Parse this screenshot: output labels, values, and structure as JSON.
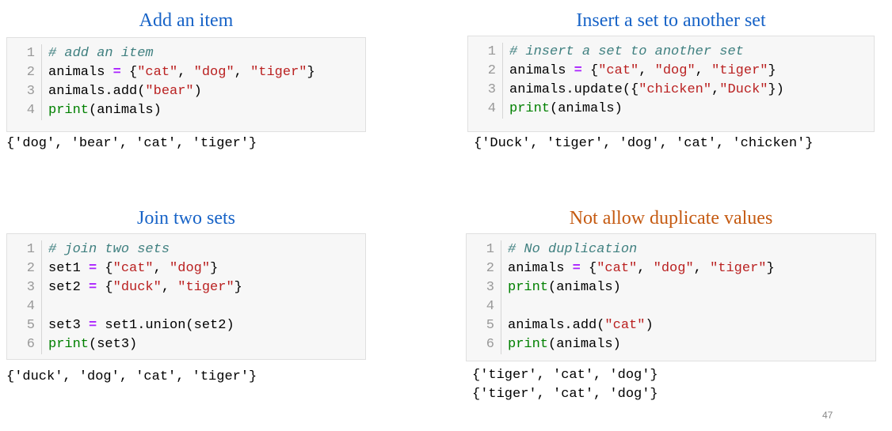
{
  "panels": {
    "add_item": {
      "title": "Add an item",
      "lines": [
        {
          "num": "1",
          "tokens": [
            {
              "t": "# add an item",
              "k": "comment"
            }
          ]
        },
        {
          "num": "2",
          "tokens": [
            {
              "t": "animals ",
              "k": "punct"
            },
            {
              "t": "=",
              "k": "op"
            },
            {
              "t": " {",
              "k": "punct"
            },
            {
              "t": "\"cat\"",
              "k": "str"
            },
            {
              "t": ", ",
              "k": "punct"
            },
            {
              "t": "\"dog\"",
              "k": "str"
            },
            {
              "t": ", ",
              "k": "punct"
            },
            {
              "t": "\"tiger\"",
              "k": "str"
            },
            {
              "t": "}",
              "k": "punct"
            }
          ]
        },
        {
          "num": "3",
          "tokens": [
            {
              "t": "animals.add(",
              "k": "punct"
            },
            {
              "t": "\"bear\"",
              "k": "str"
            },
            {
              "t": ")",
              "k": "punct"
            }
          ]
        },
        {
          "num": "4",
          "tokens": [
            {
              "t": "print",
              "k": "fn"
            },
            {
              "t": "(animals)",
              "k": "punct"
            }
          ]
        }
      ],
      "output": [
        "{'dog', 'bear', 'cat', 'tiger'}"
      ]
    },
    "insert_set": {
      "title": "Insert a set to another set",
      "lines": [
        {
          "num": "1",
          "tokens": [
            {
              "t": "# insert a set to another set",
              "k": "comment"
            }
          ]
        },
        {
          "num": "2",
          "tokens": [
            {
              "t": "animals ",
              "k": "punct"
            },
            {
              "t": "=",
              "k": "op"
            },
            {
              "t": " {",
              "k": "punct"
            },
            {
              "t": "\"cat\"",
              "k": "str"
            },
            {
              "t": ", ",
              "k": "punct"
            },
            {
              "t": "\"dog\"",
              "k": "str"
            },
            {
              "t": ", ",
              "k": "punct"
            },
            {
              "t": "\"tiger\"",
              "k": "str"
            },
            {
              "t": "}",
              "k": "punct"
            }
          ]
        },
        {
          "num": "3",
          "tokens": [
            {
              "t": "animals.update({",
              "k": "punct"
            },
            {
              "t": "\"chicken\"",
              "k": "str"
            },
            {
              "t": ",",
              "k": "punct"
            },
            {
              "t": "\"Duck\"",
              "k": "str"
            },
            {
              "t": "})",
              "k": "punct"
            }
          ]
        },
        {
          "num": "4",
          "tokens": [
            {
              "t": "print",
              "k": "fn"
            },
            {
              "t": "(animals)",
              "k": "punct"
            }
          ]
        }
      ],
      "output": [
        "{'Duck', 'tiger', 'dog', 'cat', 'chicken'}"
      ]
    },
    "join_sets": {
      "title": "Join two sets",
      "lines": [
        {
          "num": "1",
          "tokens": [
            {
              "t": "# join two sets",
              "k": "comment"
            }
          ]
        },
        {
          "num": "2",
          "tokens": [
            {
              "t": "set1 ",
              "k": "punct"
            },
            {
              "t": "=",
              "k": "op"
            },
            {
              "t": " {",
              "k": "punct"
            },
            {
              "t": "\"cat\"",
              "k": "str"
            },
            {
              "t": ", ",
              "k": "punct"
            },
            {
              "t": "\"dog\"",
              "k": "str"
            },
            {
              "t": "}",
              "k": "punct"
            }
          ]
        },
        {
          "num": "3",
          "tokens": [
            {
              "t": "set2 ",
              "k": "punct"
            },
            {
              "t": "=",
              "k": "op"
            },
            {
              "t": " {",
              "k": "punct"
            },
            {
              "t": "\"duck\"",
              "k": "str"
            },
            {
              "t": ", ",
              "k": "punct"
            },
            {
              "t": "\"tiger\"",
              "k": "str"
            },
            {
              "t": "}",
              "k": "punct"
            }
          ]
        },
        {
          "num": "4",
          "tokens": []
        },
        {
          "num": "5",
          "tokens": [
            {
              "t": "set3 ",
              "k": "punct"
            },
            {
              "t": "=",
              "k": "op"
            },
            {
              "t": " set1.union(set2)",
              "k": "punct"
            }
          ]
        },
        {
          "num": "6",
          "tokens": [
            {
              "t": "print",
              "k": "fn"
            },
            {
              "t": "(set3)",
              "k": "punct"
            }
          ]
        }
      ],
      "output": [
        "{'duck', 'dog', 'cat', 'tiger'}"
      ]
    },
    "no_duplicates": {
      "title": "Not allow duplicate values",
      "lines": [
        {
          "num": "1",
          "tokens": [
            {
              "t": "# No duplication",
              "k": "comment"
            }
          ]
        },
        {
          "num": "2",
          "tokens": [
            {
              "t": "animals ",
              "k": "punct"
            },
            {
              "t": "=",
              "k": "op"
            },
            {
              "t": " {",
              "k": "punct"
            },
            {
              "t": "\"cat\"",
              "k": "str"
            },
            {
              "t": ", ",
              "k": "punct"
            },
            {
              "t": "\"dog\"",
              "k": "str"
            },
            {
              "t": ", ",
              "k": "punct"
            },
            {
              "t": "\"tiger\"",
              "k": "str"
            },
            {
              "t": "}",
              "k": "punct"
            }
          ]
        },
        {
          "num": "3",
          "tokens": [
            {
              "t": "print",
              "k": "fn"
            },
            {
              "t": "(animals)",
              "k": "punct"
            }
          ]
        },
        {
          "num": "4",
          "tokens": []
        },
        {
          "num": "5",
          "tokens": [
            {
              "t": "animals.add(",
              "k": "punct"
            },
            {
              "t": "\"cat\"",
              "k": "str"
            },
            {
              "t": ")",
              "k": "punct"
            }
          ]
        },
        {
          "num": "6",
          "tokens": [
            {
              "t": "print",
              "k": "fn"
            },
            {
              "t": "(animals)",
              "k": "punct"
            }
          ]
        }
      ],
      "output": [
        "{'tiger', 'cat', 'dog'}",
        "{'tiger', 'cat', 'dog'}"
      ]
    }
  },
  "page_number": "47",
  "colors": {
    "title_blue": "#1763c7",
    "title_orange": "#c55a11",
    "comment": "#408080",
    "string": "#ba2121",
    "operator": "#aa22ff",
    "builtin": "#008000"
  }
}
